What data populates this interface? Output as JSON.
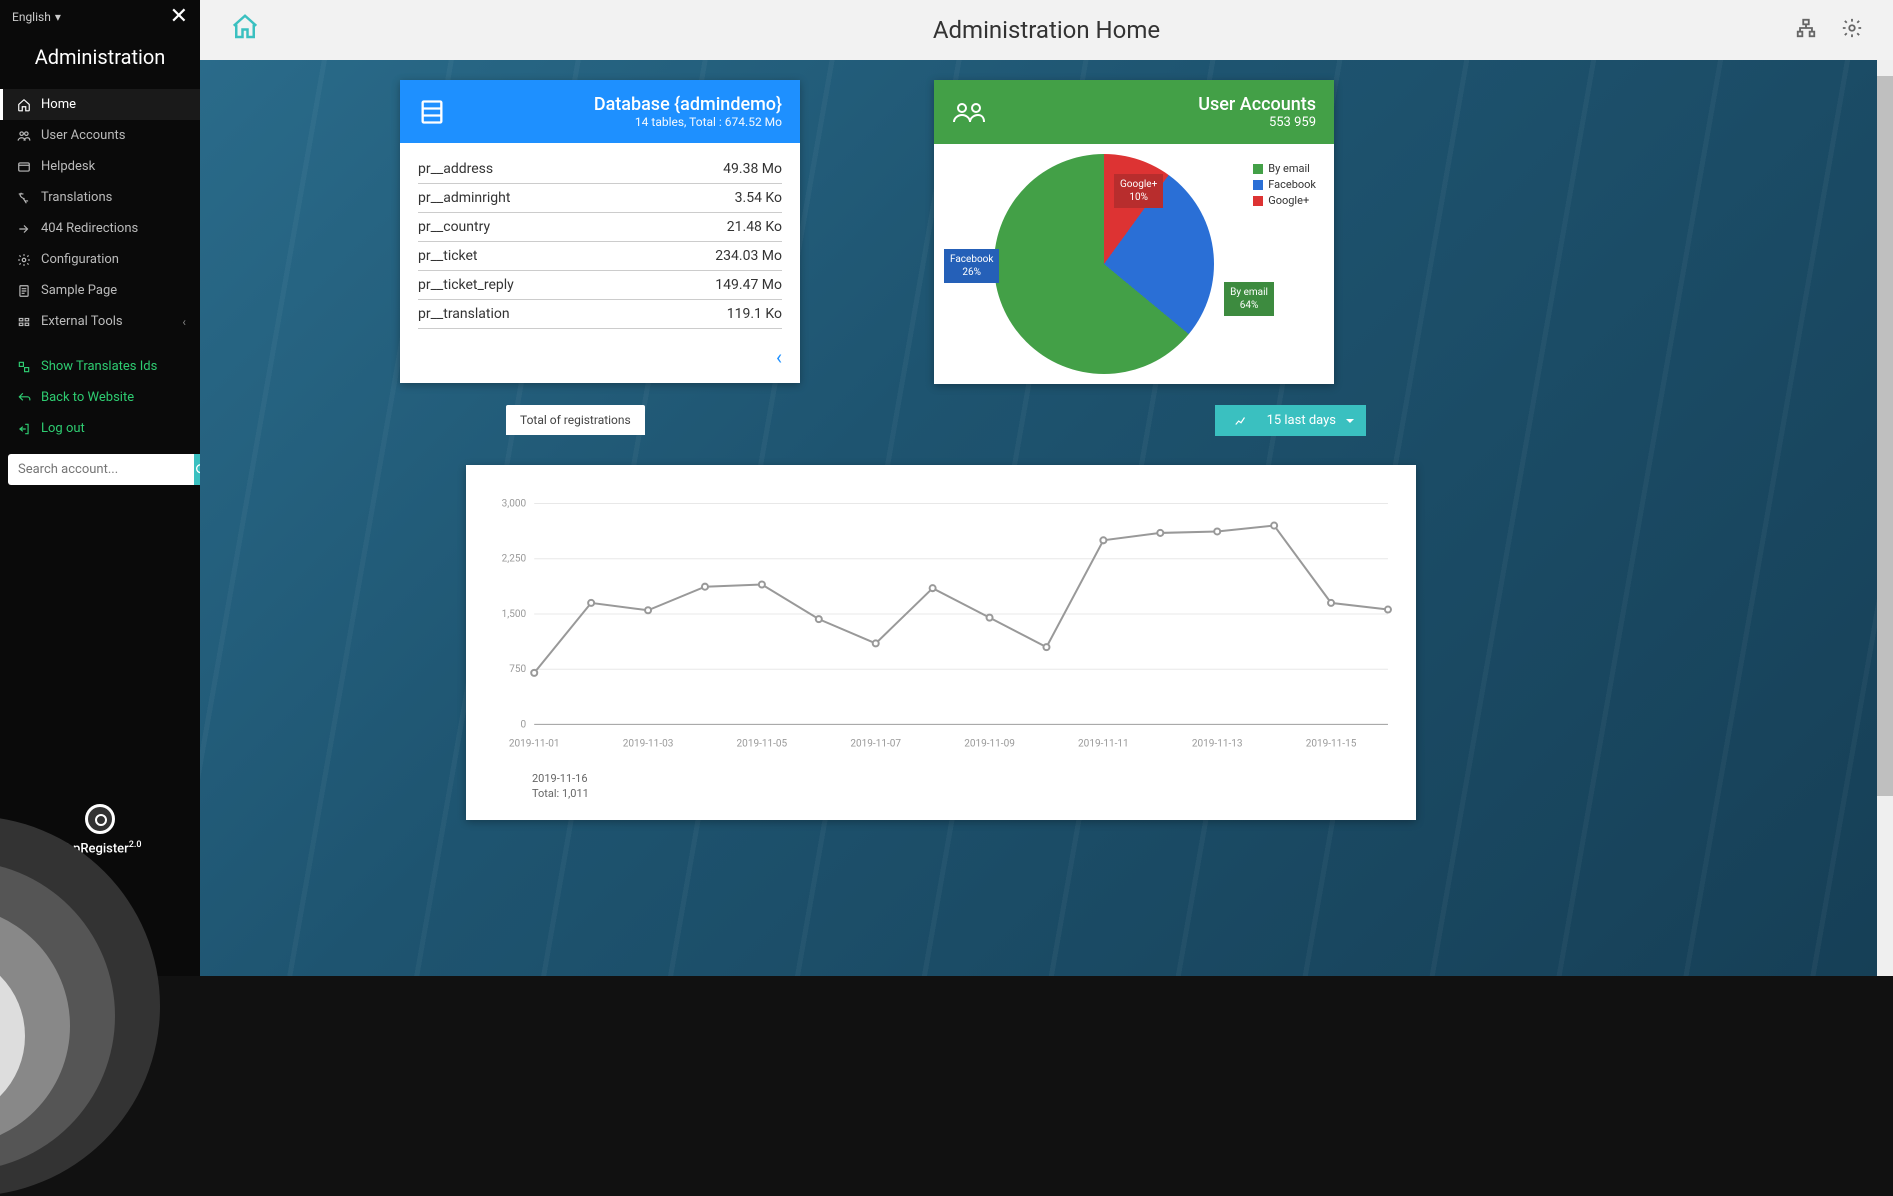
{
  "lang": "English",
  "sidebar_title": "Administration",
  "nav": [
    {
      "label": "Home",
      "icon": "home"
    },
    {
      "label": "User Accounts",
      "icon": "users"
    },
    {
      "label": "Helpdesk",
      "icon": "help"
    },
    {
      "label": "Translations",
      "icon": "translate"
    },
    {
      "label": "404 Redirections",
      "icon": "redirect"
    },
    {
      "label": "Configuration",
      "icon": "config"
    },
    {
      "label": "Sample Page",
      "icon": "page"
    },
    {
      "label": "External Tools",
      "icon": "tools"
    }
  ],
  "actions": [
    {
      "label": "Show Translates Ids"
    },
    {
      "label": "Back to Website"
    },
    {
      "label": "Log out"
    }
  ],
  "search_placeholder": "Search account...",
  "brand": {
    "name": "phpRegister",
    "ver": "2.0"
  },
  "header": {
    "title": "Administration Home"
  },
  "db_card": {
    "title": "Database {admindemo}",
    "sub": "14 tables, Total : 674.52 Mo",
    "rows": [
      {
        "name": "pr__address",
        "size": "49.38 Mo"
      },
      {
        "name": "pr__adminright",
        "size": "3.54 Ko"
      },
      {
        "name": "pr__country",
        "size": "21.48 Ko"
      },
      {
        "name": "pr__ticket",
        "size": "234.03 Mo"
      },
      {
        "name": "pr__ticket_reply",
        "size": "149.47 Mo"
      },
      {
        "name": "pr__translation",
        "size": "119.1 Ko"
      }
    ]
  },
  "ua_card": {
    "title": "User Accounts",
    "count": "553 959",
    "legend": [
      {
        "label": "By email",
        "color": "#43a047"
      },
      {
        "label": "Facebook",
        "color": "#2a6fd6"
      },
      {
        "label": "Google+",
        "color": "#d33"
      }
    ],
    "slices": {
      "email": {
        "label": "By email",
        "pct": "64%"
      },
      "facebook": {
        "label": "Facebook",
        "pct": "26%"
      },
      "google": {
        "label": "Google+",
        "pct": "10%"
      }
    }
  },
  "chart": {
    "tab": "Total of registrations",
    "period": "15 last days",
    "tooltip_date": "2019-11-16",
    "tooltip_value": "Total: 1,011"
  },
  "chart_data": {
    "type": "line",
    "title": "Total of registrations",
    "xlabel": "",
    "ylabel": "",
    "ylim": [
      0,
      3000
    ],
    "yticks": [
      0,
      750,
      1500,
      2250,
      3000
    ],
    "categories": [
      "2019-11-01",
      "2019-11-02",
      "2019-11-03",
      "2019-11-04",
      "2019-11-05",
      "2019-11-06",
      "2019-11-07",
      "2019-11-08",
      "2019-11-09",
      "2019-11-10",
      "2019-11-11",
      "2019-11-12",
      "2019-11-13",
      "2019-11-14",
      "2019-11-15",
      "2019-11-16"
    ],
    "x_ticks_shown": [
      "2019-11-01",
      "2019-11-03",
      "2019-11-05",
      "2019-11-07",
      "2019-11-09",
      "2019-11-11",
      "2019-11-13",
      "2019-11-15"
    ],
    "values": [
      700,
      1650,
      1550,
      1870,
      1900,
      1430,
      1100,
      1850,
      1450,
      1050,
      2500,
      2600,
      2620,
      2700,
      1650,
      1560,
      1011
    ]
  }
}
